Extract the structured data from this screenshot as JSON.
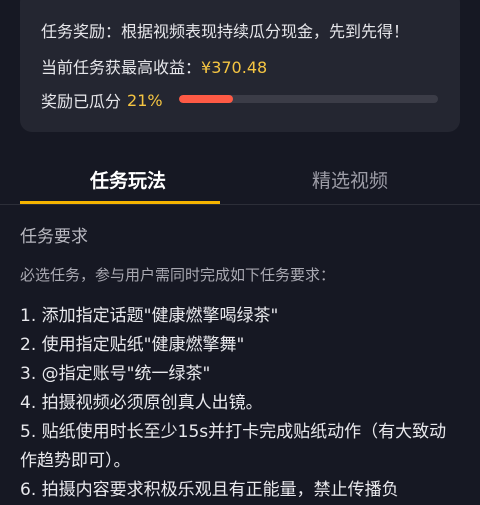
{
  "card": {
    "reward_text": "任务奖励：根据视频表现持续瓜分现金，先到先得！",
    "max_label": "当前任务获最高收益：",
    "max_amount": "¥370.48",
    "progress_label": "奖励已瓜分",
    "progress_percent": "21%",
    "progress_fraction": 0.21,
    "accent_color": "#f5c542",
    "bar_color": "#fe5a45"
  },
  "tabs": [
    {
      "label": "任务玩法",
      "active": true
    },
    {
      "label": "精选视频",
      "active": false
    }
  ],
  "content": {
    "section_title": "任务要求",
    "intro": "必选任务，参与用户需同时完成如下任务要求：",
    "requirements": [
      "1. 添加指定话题\"健康燃擎喝绿茶\"",
      "2. 使用指定贴纸\"健康燃擎舞\"",
      "3. @指定账号\"统一绿茶\"",
      "4. 拍摄视频必须原创真人出镜。",
      "5. 贴纸使用时长至少15s并打卡完成贴纸动作（有大致动作趋势即可）。",
      "6. 拍摄内容要求积极乐观且有正能量，禁止传播负"
    ]
  }
}
